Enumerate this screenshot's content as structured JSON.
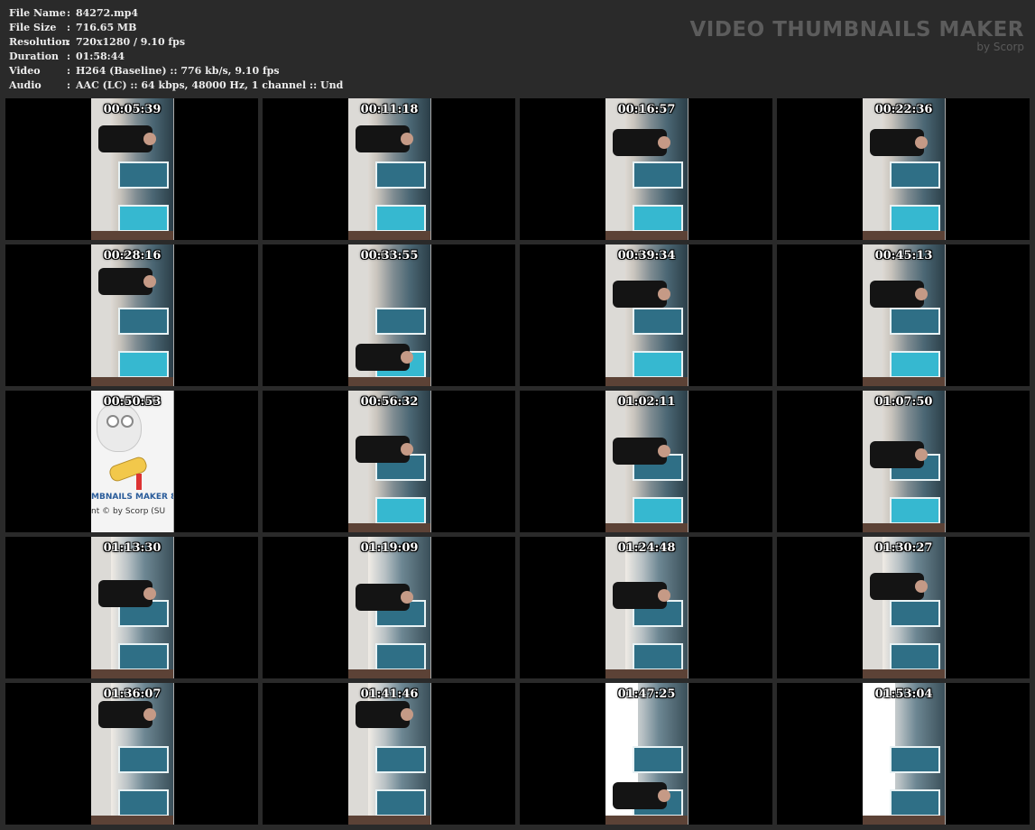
{
  "file_info": [
    {
      "key": "File Name",
      "value": "84272.mp4"
    },
    {
      "key": "File Size",
      "value": "716.65 MB"
    },
    {
      "key": "Resolution",
      "value": "720x1280 / 9.10 fps"
    },
    {
      "key": "Duration",
      "value": "01:58:44"
    },
    {
      "key": "Video",
      "value": "H264 (Baseline) :: 776 kb/s, 9.10 fps"
    },
    {
      "key": "Audio",
      "value": "AAC (LC) :: 64 kbps, 48000 Hz, 1 channel :: Und"
    }
  ],
  "separator": ":",
  "brand": {
    "title": "VIDEO THUMBNAILS MAKER",
    "subtitle": "by Scorp"
  },
  "logo_frame": {
    "line1": "MBNAILS MAKER 8",
    "line2": "nt © by Scorp (SU"
  },
  "thumbnails": [
    "00:05:39",
    "00:11:18",
    "00:16:57",
    "00:22:36",
    "00:28:16",
    "00:33:55",
    "00:39:34",
    "00:45:13",
    "00:50:53",
    "00:56:32",
    "01:02:11",
    "01:07:50",
    "01:13:30",
    "01:19:09",
    "01:24:48",
    "01:30:27",
    "01:36:07",
    "01:41:46",
    "01:47:25",
    "01:53:04"
  ]
}
